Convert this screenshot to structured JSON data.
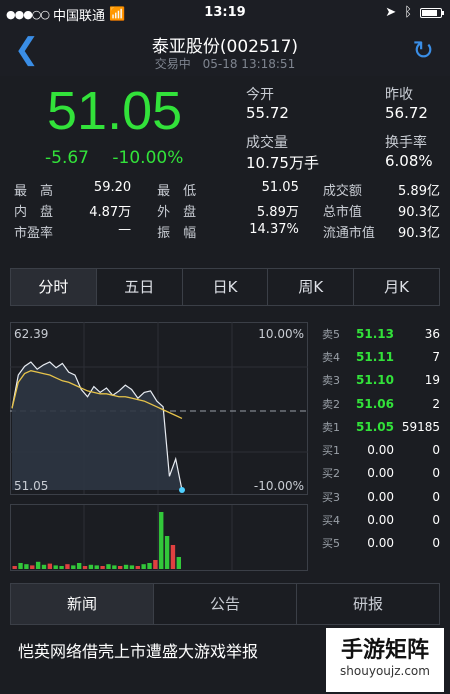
{
  "status": {
    "carrier": "中国联通",
    "time": "13:19",
    "battery_level": 0.85
  },
  "header": {
    "title": "泰亚股份(002517)",
    "state": "交易中",
    "datetime": "05-18 13:18:51"
  },
  "quote": {
    "price": "51.05",
    "change": "-5.67",
    "change_pct": "-10.00%",
    "open_label": "今开",
    "open": "55.72",
    "prev_label": "昨收",
    "prev": "56.72",
    "vol_label": "成交量",
    "vol": "10.75万手",
    "turn_label": "换手率",
    "turn": "6.08%",
    "stats": [
      {
        "label": "最　高",
        "value": "59.20"
      },
      {
        "label": "最　低",
        "value": "51.05"
      },
      {
        "label": "成交额",
        "value": "5.89亿"
      },
      {
        "label": "内　盘",
        "value": "4.87万"
      },
      {
        "label": "外　盘",
        "value": "5.89万"
      },
      {
        "label": "总市值",
        "value": "90.3亿"
      },
      {
        "label": "市盈率",
        "value": "—"
      },
      {
        "label": "振　幅",
        "value": "14.37%"
      },
      {
        "label": "流通市值",
        "value": "90.3亿"
      }
    ]
  },
  "tabs": [
    "分时",
    "五日",
    "日K",
    "周K",
    "月K"
  ],
  "chart_labels": {
    "top_price": "62.39",
    "top_pct": "10.00%",
    "bottom_price": "51.05",
    "bottom_pct": "-10.00%"
  },
  "chart_data": {
    "type": "line",
    "ylim": [
      51.05,
      62.39
    ],
    "series": [
      {
        "values": [
          56.7,
          59.0,
          59.6,
          59.9,
          59.4,
          59.7,
          59.9,
          59.5,
          59.8,
          59.2,
          59.0,
          58.0,
          57.5,
          58.2,
          57.8,
          58.1,
          57.6,
          57.9,
          58.3,
          58.0,
          57.4,
          57.8,
          57.9,
          57.2,
          56.8,
          52.0,
          53.2,
          51.05
        ]
      },
      {
        "values": [
          56.7,
          58.5,
          59.1,
          59.3,
          59.2,
          59.1,
          59.0,
          58.8,
          58.6,
          58.5,
          58.3,
          58.1,
          57.9,
          57.8,
          57.7,
          57.7,
          57.6,
          57.5,
          57.5,
          57.4,
          57.3,
          57.2,
          57.0,
          56.8,
          56.6,
          56.4,
          56.2,
          56.0
        ]
      }
    ],
    "volume": [
      0.05,
      0.1,
      0.08,
      0.06,
      0.12,
      0.07,
      0.09,
      0.06,
      0.05,
      0.08,
      0.06,
      0.1,
      0.05,
      0.07,
      0.06,
      0.05,
      0.08,
      0.06,
      0.05,
      0.07,
      0.06,
      0.05,
      0.08,
      0.1,
      0.15,
      0.95,
      0.55,
      0.4,
      0.2
    ]
  },
  "orderbook": {
    "sells": [
      {
        "label": "卖5",
        "price": "51.13",
        "vol": "36"
      },
      {
        "label": "卖4",
        "price": "51.11",
        "vol": "7"
      },
      {
        "label": "卖3",
        "price": "51.10",
        "vol": "19"
      },
      {
        "label": "卖2",
        "price": "51.06",
        "vol": "2"
      },
      {
        "label": "卖1",
        "price": "51.05",
        "vol": "59185"
      }
    ],
    "buys": [
      {
        "label": "买1",
        "price": "0.00",
        "vol": "0"
      },
      {
        "label": "买2",
        "price": "0.00",
        "vol": "0"
      },
      {
        "label": "买3",
        "price": "0.00",
        "vol": "0"
      },
      {
        "label": "买4",
        "price": "0.00",
        "vol": "0"
      },
      {
        "label": "买5",
        "price": "0.00",
        "vol": "0"
      }
    ]
  },
  "news_tabs": [
    "新闻",
    "公告",
    "研报"
  ],
  "headline": "恺英网络借壳上市遭盛大游戏举报",
  "watermark": {
    "cn": "手游矩阵",
    "url": "shouyoujz.com"
  }
}
